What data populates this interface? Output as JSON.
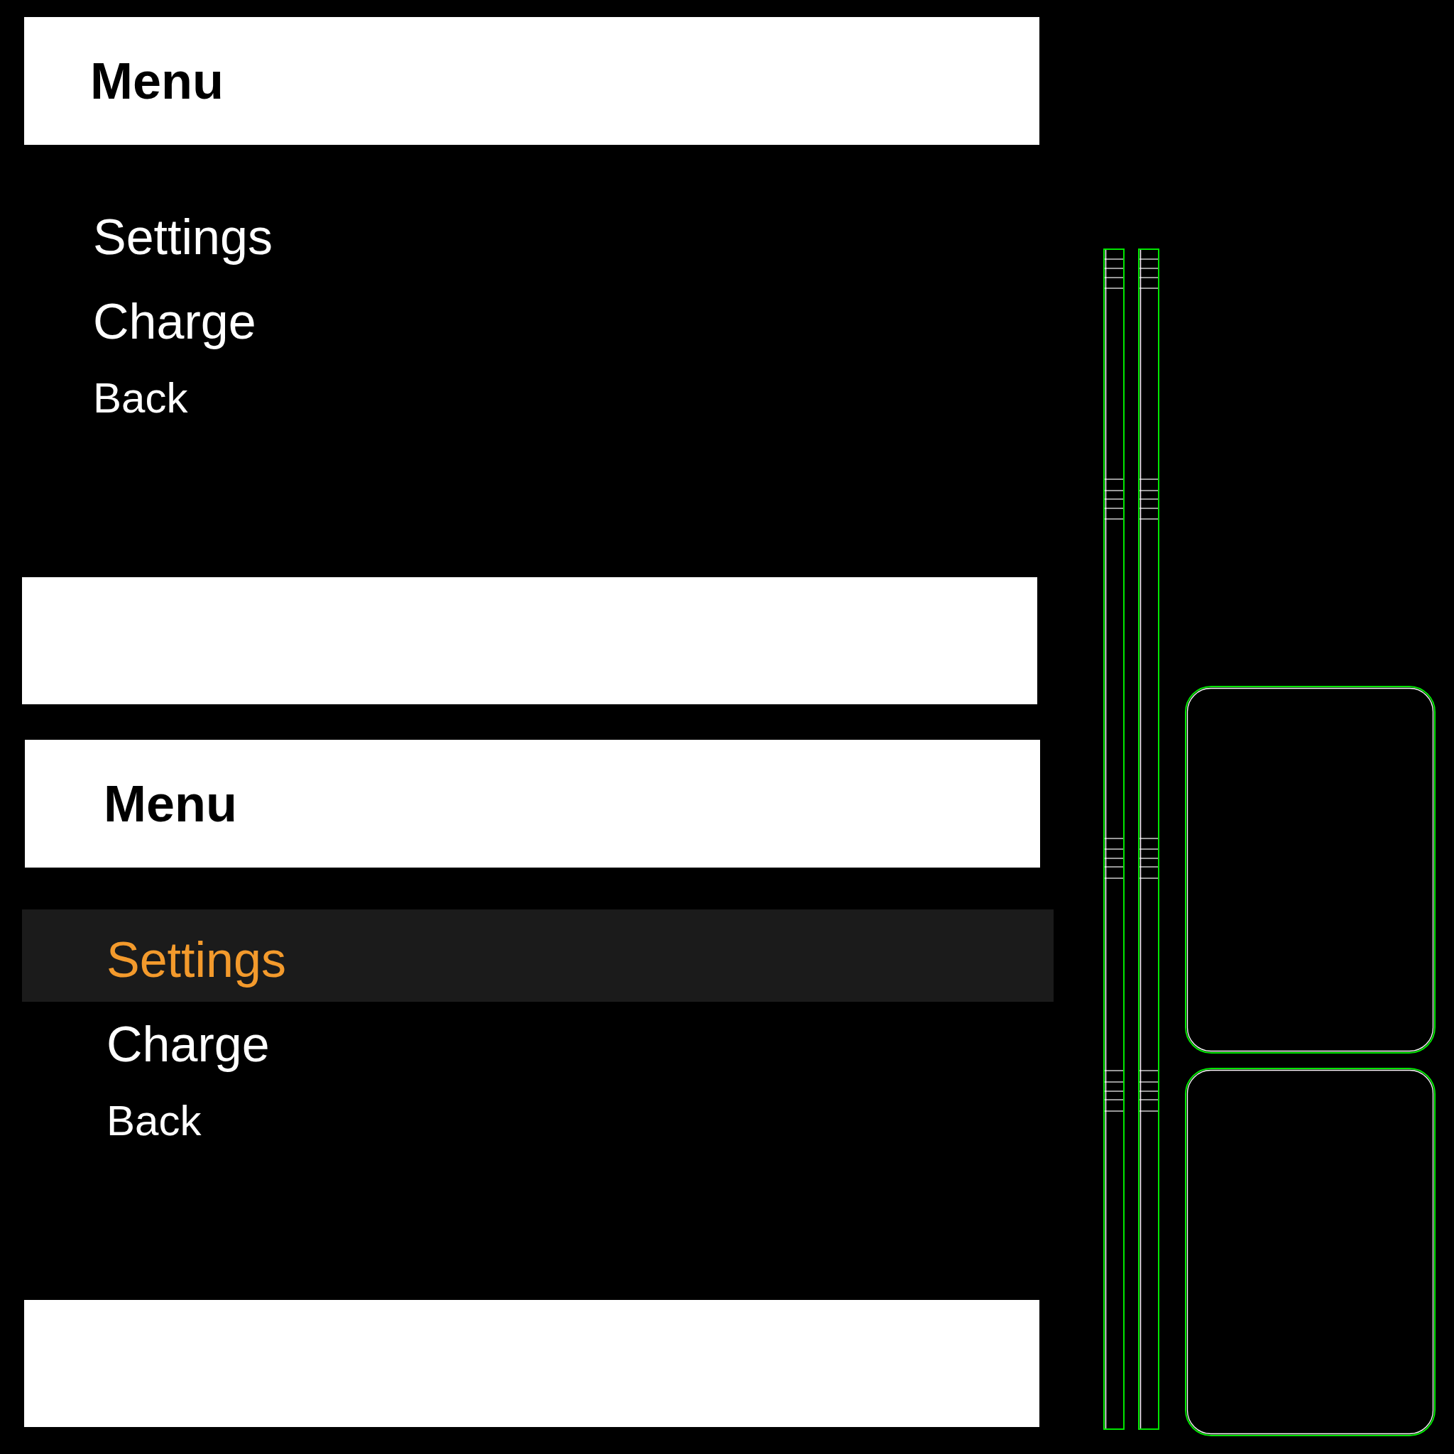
{
  "screens": [
    {
      "header": {
        "title": "Menu"
      },
      "items": [
        {
          "label": "Settings",
          "kind": "option",
          "selected": false
        },
        {
          "label": "Charge",
          "kind": "option",
          "selected": false
        },
        {
          "label": "Back",
          "kind": "back",
          "selected": false
        }
      ]
    },
    {
      "header": {
        "title": "Menu"
      },
      "items": [
        {
          "label": "Settings",
          "kind": "option",
          "selected": true
        },
        {
          "label": "Charge",
          "kind": "option",
          "selected": false
        },
        {
          "label": "Back",
          "kind": "back",
          "selected": false
        }
      ]
    }
  ]
}
